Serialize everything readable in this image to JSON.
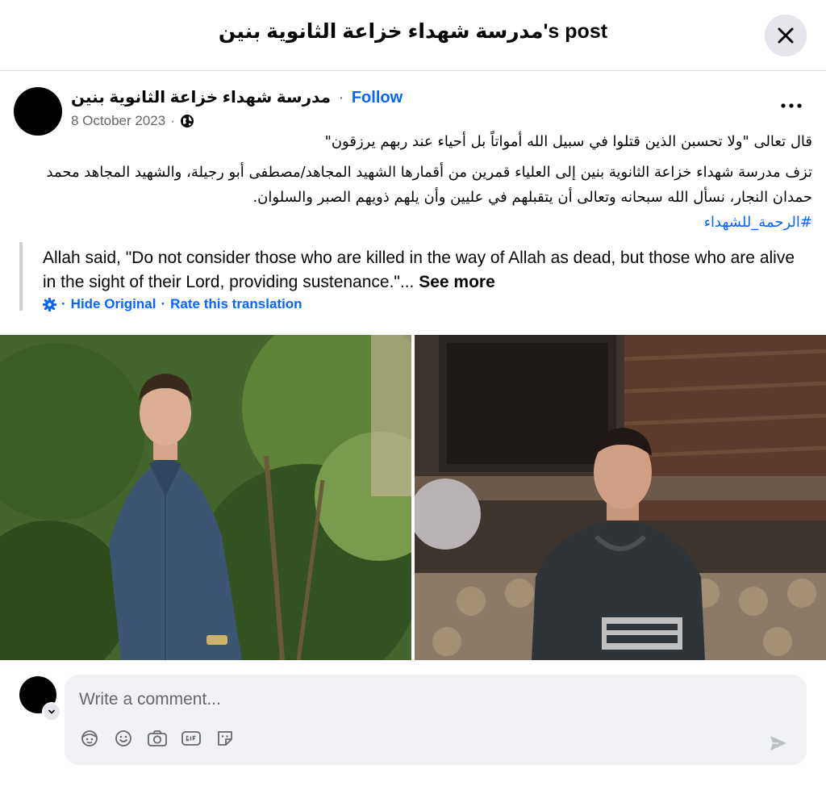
{
  "header": {
    "title": "مدرسة شهداء خزاعة الثانوية بنين's post"
  },
  "post": {
    "author": "مدرسة شهداء خزاعة الثانوية بنين",
    "separator": "·",
    "follow_label": "Follow",
    "date": "8 October 2023",
    "date_separator": "·",
    "arabic_quote": "قال تعالى \"ولا تحسبن الذين قتلوا في سبيل الله أمواتاً بل أحياء عند ربهم يرزقون\"",
    "arabic_body": "تزف مدرسة شهداء خزاعة الثانوية بنين إلى العلياء قمرين من أقمارها الشهيد المجاهد/مصطفى أبو رجيلة، والشهيد المجاهد محمد حمدان النجار، نسأل الله سبحانه وتعالى أن يتقبلهم في عليين وأن يلهم ذويهم الصبر والسلوان.",
    "hashtag": "#الرحمة_للشهداء",
    "translation": {
      "text": "Allah said, \"Do not consider those who are killed in the way of Allah as dead, but those who are alive in the sight of their Lord, providing sustenance.\"...",
      "see_more": "See more",
      "hide_original": "Hide Original",
      "separator": "·",
      "rate": "Rate this translation"
    }
  },
  "comment": {
    "placeholder": "Write a comment..."
  },
  "icons": {
    "close": "close-icon",
    "more": "more-options-icon",
    "globe": "globe-icon",
    "gear": "gear-icon",
    "avatar_sticker": "avatar-sticker-icon",
    "emoji": "emoji-icon",
    "camera": "camera-icon",
    "gif": "gif-icon",
    "sticker": "sticker-icon",
    "send": "send-icon"
  },
  "colors": {
    "link": "#0866ff",
    "secondary_text": "#65676b",
    "comment_bg": "#f0f2f5"
  }
}
